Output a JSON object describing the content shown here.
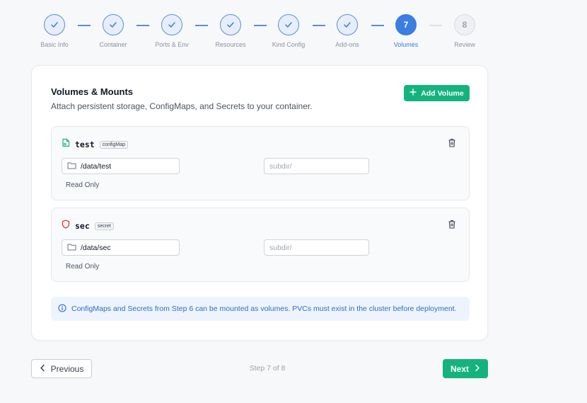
{
  "stepper": {
    "steps": [
      {
        "label": "Basic Info",
        "status": "done"
      },
      {
        "label": "Container",
        "status": "done"
      },
      {
        "label": "Ports & Env",
        "status": "done"
      },
      {
        "label": "Resources",
        "status": "done"
      },
      {
        "label": "Kind Config",
        "status": "done"
      },
      {
        "label": "Add-ons",
        "status": "done"
      },
      {
        "label": "Volumes",
        "status": "active",
        "number": "7"
      },
      {
        "label": "Review",
        "status": "todo",
        "number": "8"
      }
    ]
  },
  "card": {
    "title": "Volumes & Mounts",
    "subtitle": "Attach persistent storage, ConfigMaps, and Secrets to your container.",
    "add_button_label": "Add Volume"
  },
  "volumes": [
    {
      "name": "test",
      "type": "configMap",
      "icon": "file-config-icon",
      "mount_path": "/data/test",
      "subpath_placeholder": "subdir/",
      "read_only_label": "Read Only"
    },
    {
      "name": "sec",
      "type": "secret",
      "icon": "shield-icon",
      "mount_path": "/data/sec",
      "subpath_placeholder": "subdir/",
      "read_only_label": "Read Only"
    }
  ],
  "info": {
    "text": "ConfigMaps and Secrets from Step 6 can be mounted as volumes. PVCs must exist in the cluster before deployment."
  },
  "footer": {
    "previous_label": "Previous",
    "step_indicator": "Step 7 of 8",
    "next_label": "Next"
  },
  "colors": {
    "accent_blue": "#3b7de0",
    "accent_green": "#14b37d",
    "secret_red": "#dc2626"
  }
}
